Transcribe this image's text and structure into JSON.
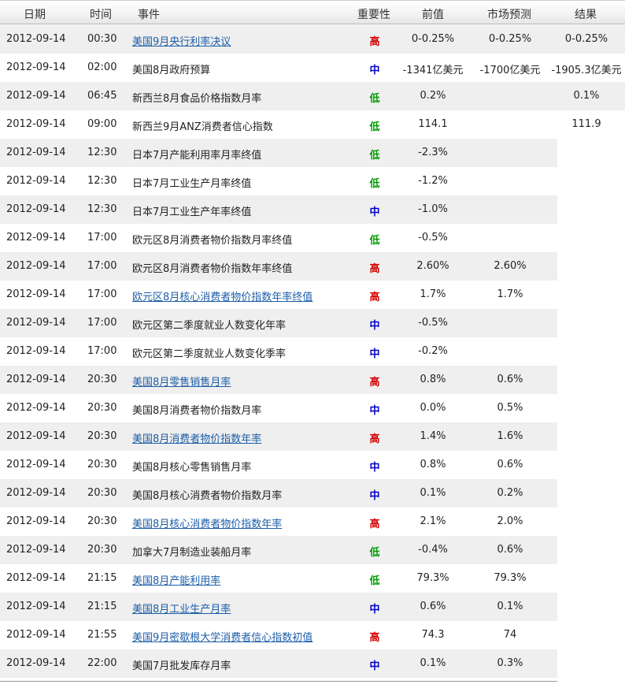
{
  "header": {
    "date": "日期",
    "time": "时间",
    "event": "事件",
    "importance": "重要性",
    "previous": "前值",
    "forecast": "市场预测",
    "result": "结果"
  },
  "colors": {
    "high": "#d40000",
    "medium": "#0000c8",
    "low": "#009a00",
    "link": "#1d5ea8"
  },
  "rows": [
    {
      "date": "2012-09-14",
      "time": "00:30",
      "event": "美国9月央行利率决议",
      "link": true,
      "importance": "高",
      "level": "hi",
      "previous": "0-0.25%",
      "forecast": "0-0.25%",
      "result": "0-0.25%"
    },
    {
      "date": "2012-09-14",
      "time": "02:00",
      "event": "美国8月政府预算",
      "link": false,
      "importance": "中",
      "level": "mid",
      "previous": "-1341亿美元",
      "forecast": "-1700亿美元",
      "result": "-1905.3亿美元"
    },
    {
      "date": "2012-09-14",
      "time": "06:45",
      "event": "新西兰8月食品价格指数月率",
      "link": false,
      "importance": "低",
      "level": "lo",
      "previous": "0.2%",
      "forecast": "",
      "result": "0.1%"
    },
    {
      "date": "2012-09-14",
      "time": "09:00",
      "event": "新西兰9月ANZ消费者信心指数",
      "link": false,
      "importance": "低",
      "level": "lo",
      "previous": "114.1",
      "forecast": "",
      "result": "111.9"
    },
    {
      "date": "2012-09-14",
      "time": "12:30",
      "event": "日本7月产能利用率月率终值",
      "link": false,
      "importance": "低",
      "level": "lo",
      "previous": "-2.3%",
      "forecast": "",
      "result": ""
    },
    {
      "date": "2012-09-14",
      "time": "12:30",
      "event": "日本7月工业生产月率终值",
      "link": false,
      "importance": "低",
      "level": "lo",
      "previous": "-1.2%",
      "forecast": "",
      "result": ""
    },
    {
      "date": "2012-09-14",
      "time": "12:30",
      "event": "日本7月工业生产年率终值",
      "link": false,
      "importance": "中",
      "level": "mid",
      "previous": "-1.0%",
      "forecast": "",
      "result": ""
    },
    {
      "date": "2012-09-14",
      "time": "17:00",
      "event": "欧元区8月消费者物价指数月率终值",
      "link": false,
      "importance": "低",
      "level": "lo",
      "previous": "-0.5%",
      "forecast": "",
      "result": ""
    },
    {
      "date": "2012-09-14",
      "time": "17:00",
      "event": "欧元区8月消费者物价指数年率终值",
      "link": false,
      "importance": "高",
      "level": "hi",
      "previous": "2.60%",
      "forecast": "2.60%",
      "result": ""
    },
    {
      "date": "2012-09-14",
      "time": "17:00",
      "event": "欧元区8月核心消费者物价指数年率终值",
      "link": true,
      "importance": "高",
      "level": "hi",
      "previous": "1.7%",
      "forecast": "1.7%",
      "result": ""
    },
    {
      "date": "2012-09-14",
      "time": "17:00",
      "event": "欧元区第二季度就业人数变化年率",
      "link": false,
      "importance": "中",
      "level": "mid",
      "previous": "-0.5%",
      "forecast": "",
      "result": ""
    },
    {
      "date": "2012-09-14",
      "time": "17:00",
      "event": "欧元区第二季度就业人数变化季率",
      "link": false,
      "importance": "中",
      "level": "mid",
      "previous": "-0.2%",
      "forecast": "",
      "result": ""
    },
    {
      "date": "2012-09-14",
      "time": "20:30",
      "event": "美国8月零售销售月率",
      "link": true,
      "importance": "高",
      "level": "hi",
      "previous": "0.8%",
      "forecast": "0.6%",
      "result": ""
    },
    {
      "date": "2012-09-14",
      "time": "20:30",
      "event": "美国8月消费者物价指数月率",
      "link": false,
      "importance": "中",
      "level": "mid",
      "previous": "0.0%",
      "forecast": "0.5%",
      "result": ""
    },
    {
      "date": "2012-09-14",
      "time": "20:30",
      "event": "美国8月消费者物价指数年率",
      "link": true,
      "importance": "高",
      "level": "hi",
      "previous": "1.4%",
      "forecast": "1.6%",
      "result": ""
    },
    {
      "date": "2012-09-14",
      "time": "20:30",
      "event": "美国8月核心零售销售月率",
      "link": false,
      "importance": "中",
      "level": "mid",
      "previous": "0.8%",
      "forecast": "0.6%",
      "result": ""
    },
    {
      "date": "2012-09-14",
      "time": "20:30",
      "event": "美国8月核心消费者物价指数月率",
      "link": false,
      "importance": "中",
      "level": "mid",
      "previous": "0.1%",
      "forecast": "0.2%",
      "result": ""
    },
    {
      "date": "2012-09-14",
      "time": "20:30",
      "event": "美国8月核心消费者物价指数年率",
      "link": true,
      "importance": "高",
      "level": "hi",
      "previous": "2.1%",
      "forecast": "2.0%",
      "result": ""
    },
    {
      "date": "2012-09-14",
      "time": "20:30",
      "event": "加拿大7月制造业装船月率",
      "link": false,
      "importance": "低",
      "level": "lo",
      "previous": "-0.4%",
      "forecast": "0.6%",
      "result": ""
    },
    {
      "date": "2012-09-14",
      "time": "21:15",
      "event": "美国8月产能利用率",
      "link": true,
      "importance": "低",
      "level": "lo",
      "previous": "79.3%",
      "forecast": "79.3%",
      "result": ""
    },
    {
      "date": "2012-09-14",
      "time": "21:15",
      "event": "美国8月工业生产月率",
      "link": true,
      "importance": "中",
      "level": "mid",
      "previous": "0.6%",
      "forecast": "0.1%",
      "result": ""
    },
    {
      "date": "2012-09-14",
      "time": "21:55",
      "event": "美国9月密歇根大学消费者信心指数初值",
      "link": true,
      "importance": "高",
      "level": "hi",
      "previous": "74.3",
      "forecast": "74",
      "result": ""
    },
    {
      "date": "2012-09-14",
      "time": "22:00",
      "event": "美国7月批发库存月率",
      "link": false,
      "importance": "中",
      "level": "mid",
      "previous": "0.1%",
      "forecast": "0.3%",
      "result": ""
    }
  ]
}
